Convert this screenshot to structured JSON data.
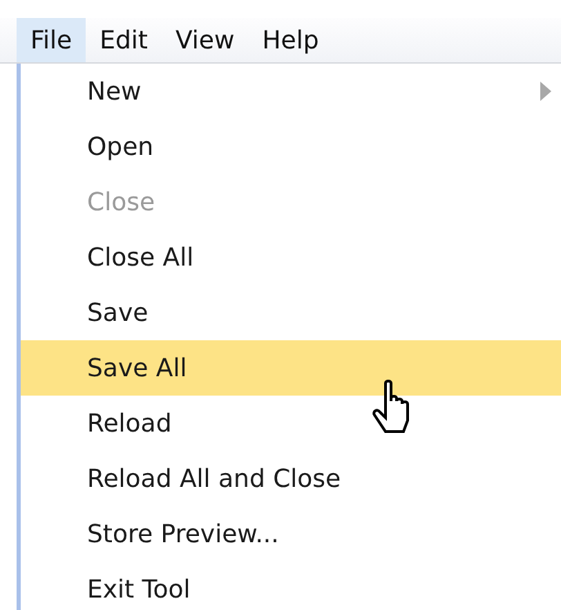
{
  "menubar": [
    {
      "label": "File",
      "selected": true
    },
    {
      "label": "Edit",
      "selected": false
    },
    {
      "label": "View",
      "selected": false
    },
    {
      "label": "Help",
      "selected": false
    }
  ],
  "menu": [
    {
      "label": "New",
      "disabled": false,
      "selected": false,
      "submenu": true
    },
    {
      "label": "Open",
      "disabled": false,
      "selected": false,
      "submenu": false
    },
    {
      "label": "Close",
      "disabled": true,
      "selected": false,
      "submenu": false
    },
    {
      "label": "Close All",
      "disabled": false,
      "selected": false,
      "submenu": false
    },
    {
      "label": "Save",
      "disabled": false,
      "selected": false,
      "submenu": false
    },
    {
      "label": "Save All",
      "disabled": false,
      "selected": true,
      "submenu": false
    },
    {
      "label": "Reload",
      "disabled": false,
      "selected": false,
      "submenu": false
    },
    {
      "label": "Reload All and Close",
      "disabled": false,
      "selected": false,
      "submenu": false
    },
    {
      "label": "Store Preview...",
      "disabled": false,
      "selected": false,
      "submenu": false
    },
    {
      "label": "Exit Tool",
      "disabled": false,
      "selected": false,
      "submenu": false
    }
  ]
}
